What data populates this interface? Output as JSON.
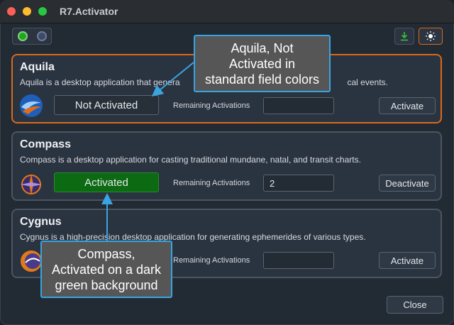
{
  "window": {
    "title": "R7.Activator"
  },
  "apps": [
    {
      "name": "Aquila",
      "description": "Aquila is a desktop application that generates... [partially covered] ...cal events.",
      "description_left": "Aquila is a desktop application that genera",
      "description_right": "cal events.",
      "status": "Not Activated",
      "remaining_label": "Remaining Activations",
      "remaining_value": "",
      "action_label": "Activate"
    },
    {
      "name": "Compass",
      "description": "Compass is a desktop application for casting traditional mundane, natal, and transit charts.",
      "status": "Activated",
      "remaining_label": "Remaining Activations",
      "remaining_value": "2",
      "action_label": "Deactivate"
    },
    {
      "name": "Cygnus",
      "description": "Cygnus is a high-precision desktop application for generating ephemerides of various types.",
      "status": "",
      "remaining_label": "Remaining Activations",
      "remaining_value": "",
      "action_label": "Activate"
    }
  ],
  "footer": {
    "close_label": "Close"
  },
  "callouts": {
    "aquila": [
      "Aquila, Not",
      "Activated in",
      "standard field colors"
    ],
    "compass": [
      "Compass,",
      "Activated on a dark",
      "green background"
    ]
  },
  "colors": {
    "selection_border": "#d96a1b",
    "activated_bg": "#0b6a12",
    "callout_border": "#3aa4e0"
  }
}
